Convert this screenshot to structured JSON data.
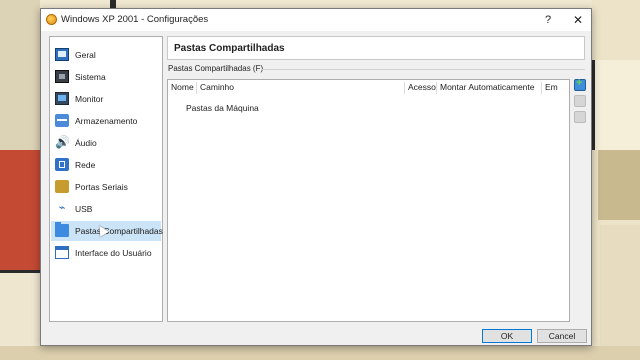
{
  "window": {
    "title": "Windows XP 2001 - Configurações",
    "help_label": "?",
    "close_label": "✕",
    "app_icon": "virtualbox-icon"
  },
  "sidebar": {
    "items": [
      {
        "label": "Geral",
        "icon": "general-icon"
      },
      {
        "label": "Sistema",
        "icon": "chip-icon"
      },
      {
        "label": "Monitor",
        "icon": "monitor-icon"
      },
      {
        "label": "Armazenamento",
        "icon": "storage-icon"
      },
      {
        "label": "Áudio",
        "icon": "audio-icon"
      },
      {
        "label": "Rede",
        "icon": "network-icon"
      },
      {
        "label": "Portas Seriais",
        "icon": "serial-port-icon"
      },
      {
        "label": "USB",
        "icon": "usb-icon"
      },
      {
        "label": "Pastas Compartilhadas",
        "icon": "shared-folder-icon",
        "selected": true
      },
      {
        "label": "Interface do Usuário",
        "icon": "user-interface-icon"
      }
    ]
  },
  "page": {
    "title": "Pastas Compartilhadas",
    "group_label": "Pastas Compartilhadas (F)",
    "table": {
      "columns": [
        "Nome",
        "Caminho",
        "Acesso",
        "Montar Automaticamente",
        "Em"
      ],
      "rows": [
        {
          "label": "Pastas da Máquina"
        }
      ]
    }
  },
  "buttons": {
    "ok": "OK",
    "cancel": "Cancel"
  },
  "colors": {
    "selection": "#cce4f7",
    "accent": "#0078d7"
  }
}
